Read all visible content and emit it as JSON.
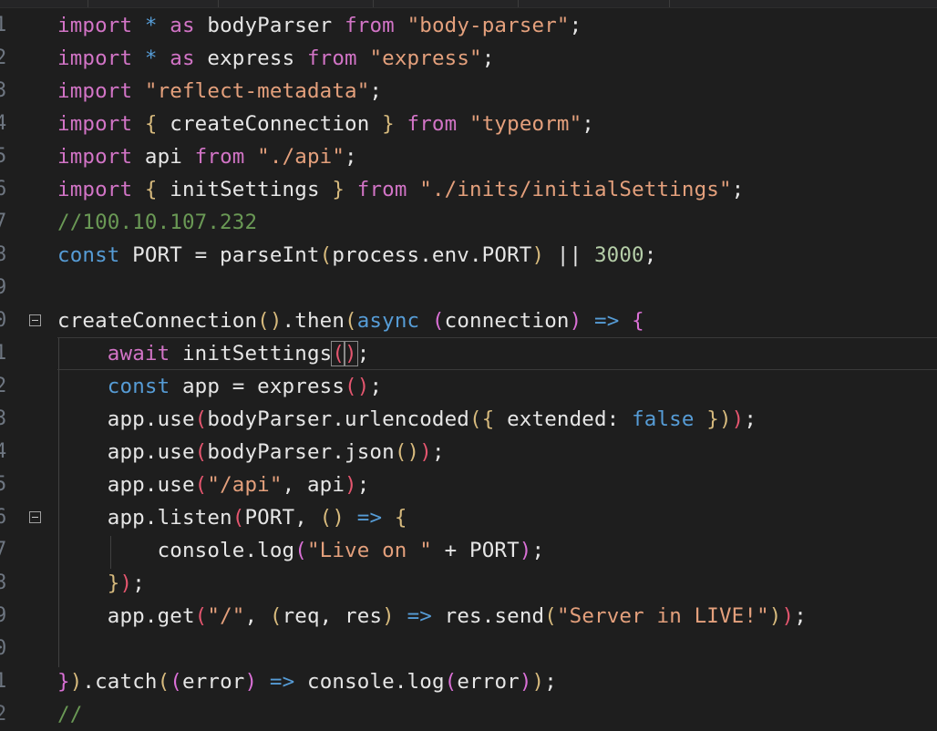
{
  "editor": {
    "colors": {
      "background": "#1e1e1e",
      "keyword": "#d274c6",
      "string": "#e4a07c",
      "comment": "#6a9955",
      "number": "#b5cea8",
      "declaration": "#569cd6",
      "paren_level1": "#d7ba7d",
      "paren_level2": "#da70d6",
      "paren_level3": "#e5566f",
      "line_number": "#6e7681"
    },
    "lines": [
      {
        "number": "1",
        "tokens": [
          {
            "t": "import",
            "c": "imp"
          },
          {
            "t": " ",
            "c": "punct"
          },
          {
            "t": "*",
            "c": "star"
          },
          {
            "t": " as ",
            "c": "imp"
          },
          {
            "t": "bodyParser",
            "c": "ident"
          },
          {
            "t": " ",
            "c": "punct"
          },
          {
            "t": "from",
            "c": "imp"
          },
          {
            "t": " ",
            "c": "punct"
          },
          {
            "t": "\"body-parser\"",
            "c": "str"
          },
          {
            "t": ";",
            "c": "punct"
          }
        ]
      },
      {
        "number": "2",
        "tokens": [
          {
            "t": "import",
            "c": "imp"
          },
          {
            "t": " ",
            "c": "punct"
          },
          {
            "t": "*",
            "c": "star"
          },
          {
            "t": " as ",
            "c": "imp"
          },
          {
            "t": "express",
            "c": "ident"
          },
          {
            "t": " ",
            "c": "punct"
          },
          {
            "t": "from",
            "c": "imp"
          },
          {
            "t": " ",
            "c": "punct"
          },
          {
            "t": "\"express\"",
            "c": "str"
          },
          {
            "t": ";",
            "c": "punct"
          }
        ]
      },
      {
        "number": "3",
        "tokens": [
          {
            "t": "import",
            "c": "imp"
          },
          {
            "t": " ",
            "c": "punct"
          },
          {
            "t": "\"reflect-metadata\"",
            "c": "str"
          },
          {
            "t": ";",
            "c": "punct"
          }
        ]
      },
      {
        "number": "4",
        "tokens": [
          {
            "t": "import",
            "c": "imp"
          },
          {
            "t": " ",
            "c": "punct"
          },
          {
            "t": "{",
            "c": "p1"
          },
          {
            "t": " createConnection ",
            "c": "ident"
          },
          {
            "t": "}",
            "c": "p1"
          },
          {
            "t": " ",
            "c": "punct"
          },
          {
            "t": "from",
            "c": "imp"
          },
          {
            "t": " ",
            "c": "punct"
          },
          {
            "t": "\"typeorm\"",
            "c": "str"
          },
          {
            "t": ";",
            "c": "punct"
          }
        ]
      },
      {
        "number": "5",
        "tokens": [
          {
            "t": "import",
            "c": "imp"
          },
          {
            "t": " api ",
            "c": "ident"
          },
          {
            "t": "from",
            "c": "imp"
          },
          {
            "t": " ",
            "c": "punct"
          },
          {
            "t": "\"./api\"",
            "c": "str"
          },
          {
            "t": ";",
            "c": "punct"
          }
        ]
      },
      {
        "number": "6",
        "tokens": [
          {
            "t": "import",
            "c": "imp"
          },
          {
            "t": " ",
            "c": "punct"
          },
          {
            "t": "{",
            "c": "p1"
          },
          {
            "t": " initSettings ",
            "c": "ident"
          },
          {
            "t": "}",
            "c": "p1"
          },
          {
            "t": " ",
            "c": "punct"
          },
          {
            "t": "from",
            "c": "imp"
          },
          {
            "t": " ",
            "c": "punct"
          },
          {
            "t": "\"./inits/initialSettings\"",
            "c": "str"
          },
          {
            "t": ";",
            "c": "punct"
          }
        ]
      },
      {
        "number": "7",
        "tokens": [
          {
            "t": "//100.10.107.232",
            "c": "cmt"
          }
        ]
      },
      {
        "number": "8",
        "tokens": [
          {
            "t": "const",
            "c": "decl"
          },
          {
            "t": " PORT = parseInt",
            "c": "ident"
          },
          {
            "t": "(",
            "c": "p1"
          },
          {
            "t": "process.env.PORT",
            "c": "ident"
          },
          {
            "t": ")",
            "c": "p1"
          },
          {
            "t": " || ",
            "c": "op"
          },
          {
            "t": "3000",
            "c": "num"
          },
          {
            "t": ";",
            "c": "punct"
          }
        ]
      },
      {
        "number": "9",
        "tokens": []
      },
      {
        "number": "0",
        "fold": true,
        "tokens": [
          {
            "t": "createConnection",
            "c": "ident"
          },
          {
            "t": "()",
            "c": "p1"
          },
          {
            "t": ".then",
            "c": "ident"
          },
          {
            "t": "(",
            "c": "p1"
          },
          {
            "t": "async",
            "c": "decl"
          },
          {
            "t": " ",
            "c": "punct"
          },
          {
            "t": "(",
            "c": "p2"
          },
          {
            "t": "connection",
            "c": "ident"
          },
          {
            "t": ")",
            "c": "p2"
          },
          {
            "t": " ",
            "c": "punct"
          },
          {
            "t": "=>",
            "c": "arrow"
          },
          {
            "t": " ",
            "c": "punct"
          },
          {
            "t": "{",
            "c": "p2"
          }
        ]
      },
      {
        "number": "1",
        "current": true,
        "tokens": [
          {
            "t": "    ",
            "c": "punct"
          },
          {
            "t": "await",
            "c": "await"
          },
          {
            "t": " initSettings",
            "c": "ident"
          },
          {
            "t": "(",
            "c": "p3",
            "box": true
          },
          {
            "t": "CURSOR",
            "c": "cursor"
          },
          {
            "t": ")",
            "c": "p3",
            "box": true
          },
          {
            "t": ";",
            "c": "punct"
          }
        ]
      },
      {
        "number": "2",
        "tokens": [
          {
            "t": "    ",
            "c": "punct"
          },
          {
            "t": "const",
            "c": "decl"
          },
          {
            "t": " app = express",
            "c": "ident"
          },
          {
            "t": "()",
            "c": "p3"
          },
          {
            "t": ";",
            "c": "punct"
          }
        ]
      },
      {
        "number": "3",
        "tokens": [
          {
            "t": "    app.use",
            "c": "ident"
          },
          {
            "t": "(",
            "c": "p3"
          },
          {
            "t": "bodyParser.urlencoded",
            "c": "ident"
          },
          {
            "t": "(",
            "c": "p1"
          },
          {
            "t": "{",
            "c": "p1"
          },
          {
            "t": " extended: ",
            "c": "ident"
          },
          {
            "t": "false",
            "c": "bool"
          },
          {
            "t": " ",
            "c": "punct"
          },
          {
            "t": "}",
            "c": "p1"
          },
          {
            "t": ")",
            "c": "p1"
          },
          {
            "t": ")",
            "c": "p3"
          },
          {
            "t": ";",
            "c": "punct"
          }
        ]
      },
      {
        "number": "4",
        "tokens": [
          {
            "t": "    app.use",
            "c": "ident"
          },
          {
            "t": "(",
            "c": "p3"
          },
          {
            "t": "bodyParser.json",
            "c": "ident"
          },
          {
            "t": "()",
            "c": "p1"
          },
          {
            "t": ")",
            "c": "p3"
          },
          {
            "t": ";",
            "c": "punct"
          }
        ]
      },
      {
        "number": "5",
        "tokens": [
          {
            "t": "    app.use",
            "c": "ident"
          },
          {
            "t": "(",
            "c": "p3"
          },
          {
            "t": "\"/api\"",
            "c": "str"
          },
          {
            "t": ", api",
            "c": "ident"
          },
          {
            "t": ")",
            "c": "p3"
          },
          {
            "t": ";",
            "c": "punct"
          }
        ]
      },
      {
        "number": "6",
        "fold": true,
        "tokens": [
          {
            "t": "    app.listen",
            "c": "ident"
          },
          {
            "t": "(",
            "c": "p3"
          },
          {
            "t": "PORT, ",
            "c": "ident"
          },
          {
            "t": "()",
            "c": "p1"
          },
          {
            "t": " ",
            "c": "punct"
          },
          {
            "t": "=>",
            "c": "arrow"
          },
          {
            "t": " ",
            "c": "punct"
          },
          {
            "t": "{",
            "c": "p1"
          }
        ]
      },
      {
        "number": "7",
        "tokens": [
          {
            "t": "        console.log",
            "c": "ident"
          },
          {
            "t": "(",
            "c": "p2"
          },
          {
            "t": "\"Live on \"",
            "c": "str"
          },
          {
            "t": " + PORT",
            "c": "ident"
          },
          {
            "t": ")",
            "c": "p2"
          },
          {
            "t": ";",
            "c": "punct"
          }
        ]
      },
      {
        "number": "8",
        "tokens": [
          {
            "t": "    ",
            "c": "punct"
          },
          {
            "t": "}",
            "c": "p1"
          },
          {
            "t": ")",
            "c": "p3"
          },
          {
            "t": ";",
            "c": "punct"
          }
        ]
      },
      {
        "number": "9",
        "tokens": [
          {
            "t": "    app.get",
            "c": "ident"
          },
          {
            "t": "(",
            "c": "p3"
          },
          {
            "t": "\"/\"",
            "c": "str"
          },
          {
            "t": ", ",
            "c": "punct"
          },
          {
            "t": "(",
            "c": "p1"
          },
          {
            "t": "req, res",
            "c": "ident"
          },
          {
            "t": ")",
            "c": "p1"
          },
          {
            "t": " ",
            "c": "punct"
          },
          {
            "t": "=>",
            "c": "arrow"
          },
          {
            "t": " res.send",
            "c": "ident"
          },
          {
            "t": "(",
            "c": "p1"
          },
          {
            "t": "\"Server in LIVE!\"",
            "c": "str"
          },
          {
            "t": ")",
            "c": "p1"
          },
          {
            "t": ")",
            "c": "p3"
          },
          {
            "t": ";",
            "c": "punct"
          }
        ]
      },
      {
        "number": "0",
        "tokens": []
      },
      {
        "number": "1",
        "tokens": [
          {
            "t": "}",
            "c": "p2"
          },
          {
            "t": ")",
            "c": "p1"
          },
          {
            "t": ".catch",
            "c": "ident"
          },
          {
            "t": "(",
            "c": "p1"
          },
          {
            "t": "(",
            "c": "p2"
          },
          {
            "t": "error",
            "c": "ident"
          },
          {
            "t": ")",
            "c": "p2"
          },
          {
            "t": " ",
            "c": "punct"
          },
          {
            "t": "=>",
            "c": "arrow"
          },
          {
            "t": " console.log",
            "c": "ident"
          },
          {
            "t": "(",
            "c": "p2"
          },
          {
            "t": "error",
            "c": "ident"
          },
          {
            "t": ")",
            "c": "p2"
          },
          {
            "t": ")",
            "c": "p1"
          },
          {
            "t": ";",
            "c": "punct"
          }
        ]
      },
      {
        "number": "2",
        "partial": true,
        "tokens": [
          {
            "t": "//",
            "c": "cmt"
          }
        ]
      }
    ]
  }
}
